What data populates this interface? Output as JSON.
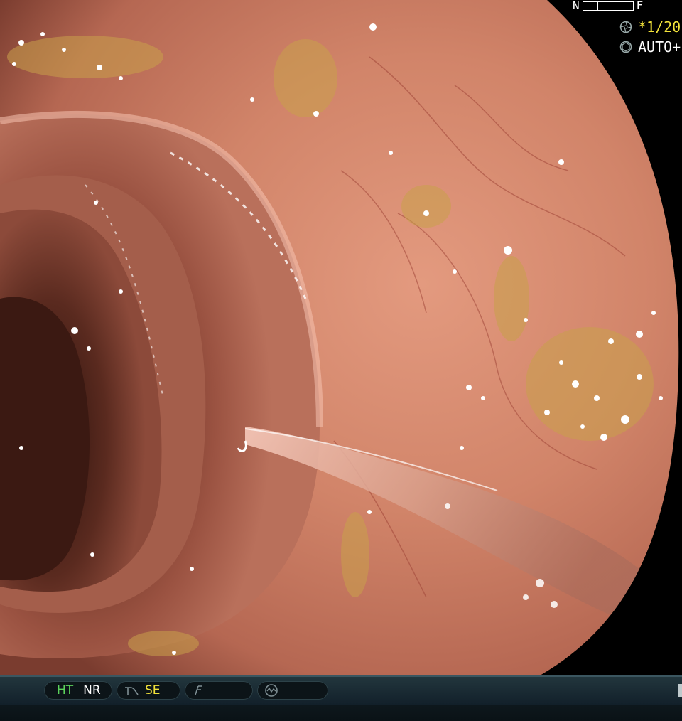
{
  "osd": {
    "nf_left": "N",
    "nf_right": "F",
    "shutter_text": "*1/20",
    "mode_text": "AUTO+"
  },
  "status_bar": {
    "ht": "HT",
    "nr": "NR",
    "se": "SE"
  },
  "icons": {
    "shutter": "shutter-icon",
    "iris": "iris-icon",
    "enhance": "structure-enhance-icon",
    "contrast": "contrast-icon",
    "dial": "dial-icon"
  },
  "colors": {
    "osd_yellow": "#f2e23a",
    "status_green": "#5bd25b",
    "mucosa": "#c87a62"
  }
}
